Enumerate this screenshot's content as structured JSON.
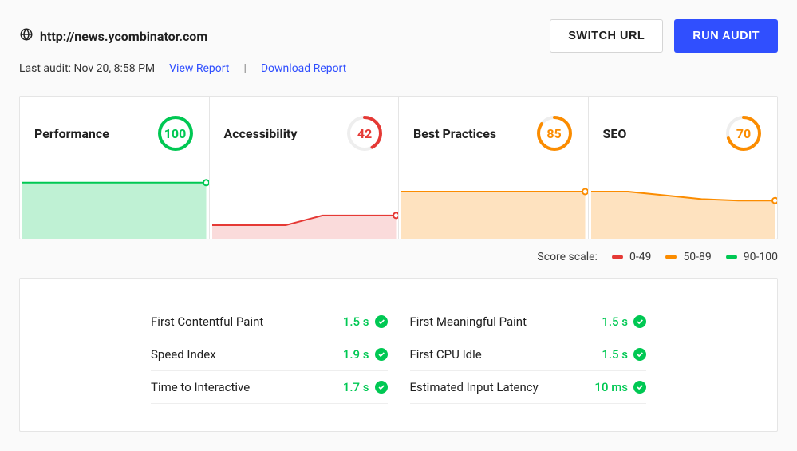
{
  "header": {
    "url": "http://news.ycombinator.com",
    "last_audit_label": "Last audit: Nov 20, 8:58 PM",
    "view_report": "View Report",
    "download_report": "Download Report",
    "switch_url": "SWITCH URL",
    "run_audit": "RUN AUDIT"
  },
  "scale": {
    "label": "Score scale:",
    "low": "0-49",
    "mid": "50-89",
    "high": "90-100"
  },
  "colors": {
    "green": "#00c853",
    "orange": "#fb8c00",
    "red": "#e53935"
  },
  "cards": [
    {
      "title": "Performance",
      "score": 100,
      "band": "high",
      "spark": [
        72,
        72,
        72,
        72,
        72,
        72
      ]
    },
    {
      "title": "Accessibility",
      "score": 42,
      "band": "low",
      "spark": [
        15,
        15,
        15,
        28,
        28,
        28
      ]
    },
    {
      "title": "Best Practices",
      "score": 85,
      "band": "mid",
      "spark": [
        60,
        60,
        60,
        60,
        60,
        60
      ]
    },
    {
      "title": "SEO",
      "score": 70,
      "band": "mid",
      "spark": [
        60,
        60,
        55,
        50,
        48,
        48
      ]
    }
  ],
  "metrics_left": [
    {
      "name": "First Contentful Paint",
      "value": "1.5 s",
      "band": "high"
    },
    {
      "name": "Speed Index",
      "value": "1.9 s",
      "band": "high"
    },
    {
      "name": "Time to Interactive",
      "value": "1.7 s",
      "band": "high"
    }
  ],
  "metrics_right": [
    {
      "name": "First Meaningful Paint",
      "value": "1.5 s",
      "band": "high"
    },
    {
      "name": "First CPU Idle",
      "value": "1.5 s",
      "band": "high"
    },
    {
      "name": "Estimated Input Latency",
      "value": "10 ms",
      "band": "high"
    }
  ],
  "chart_data": {
    "type": "table",
    "title": "Lighthouse audit scores",
    "categories": [
      "Performance",
      "Accessibility",
      "Best Practices",
      "SEO"
    ],
    "values": [
      100,
      42,
      85,
      70
    ],
    "metrics": [
      {
        "name": "First Contentful Paint",
        "value": 1.5,
        "unit": "s"
      },
      {
        "name": "Speed Index",
        "value": 1.9,
        "unit": "s"
      },
      {
        "name": "Time to Interactive",
        "value": 1.7,
        "unit": "s"
      },
      {
        "name": "First Meaningful Paint",
        "value": 1.5,
        "unit": "s"
      },
      {
        "name": "First CPU Idle",
        "value": 1.5,
        "unit": "s"
      },
      {
        "name": "Estimated Input Latency",
        "value": 10,
        "unit": "ms"
      }
    ]
  }
}
